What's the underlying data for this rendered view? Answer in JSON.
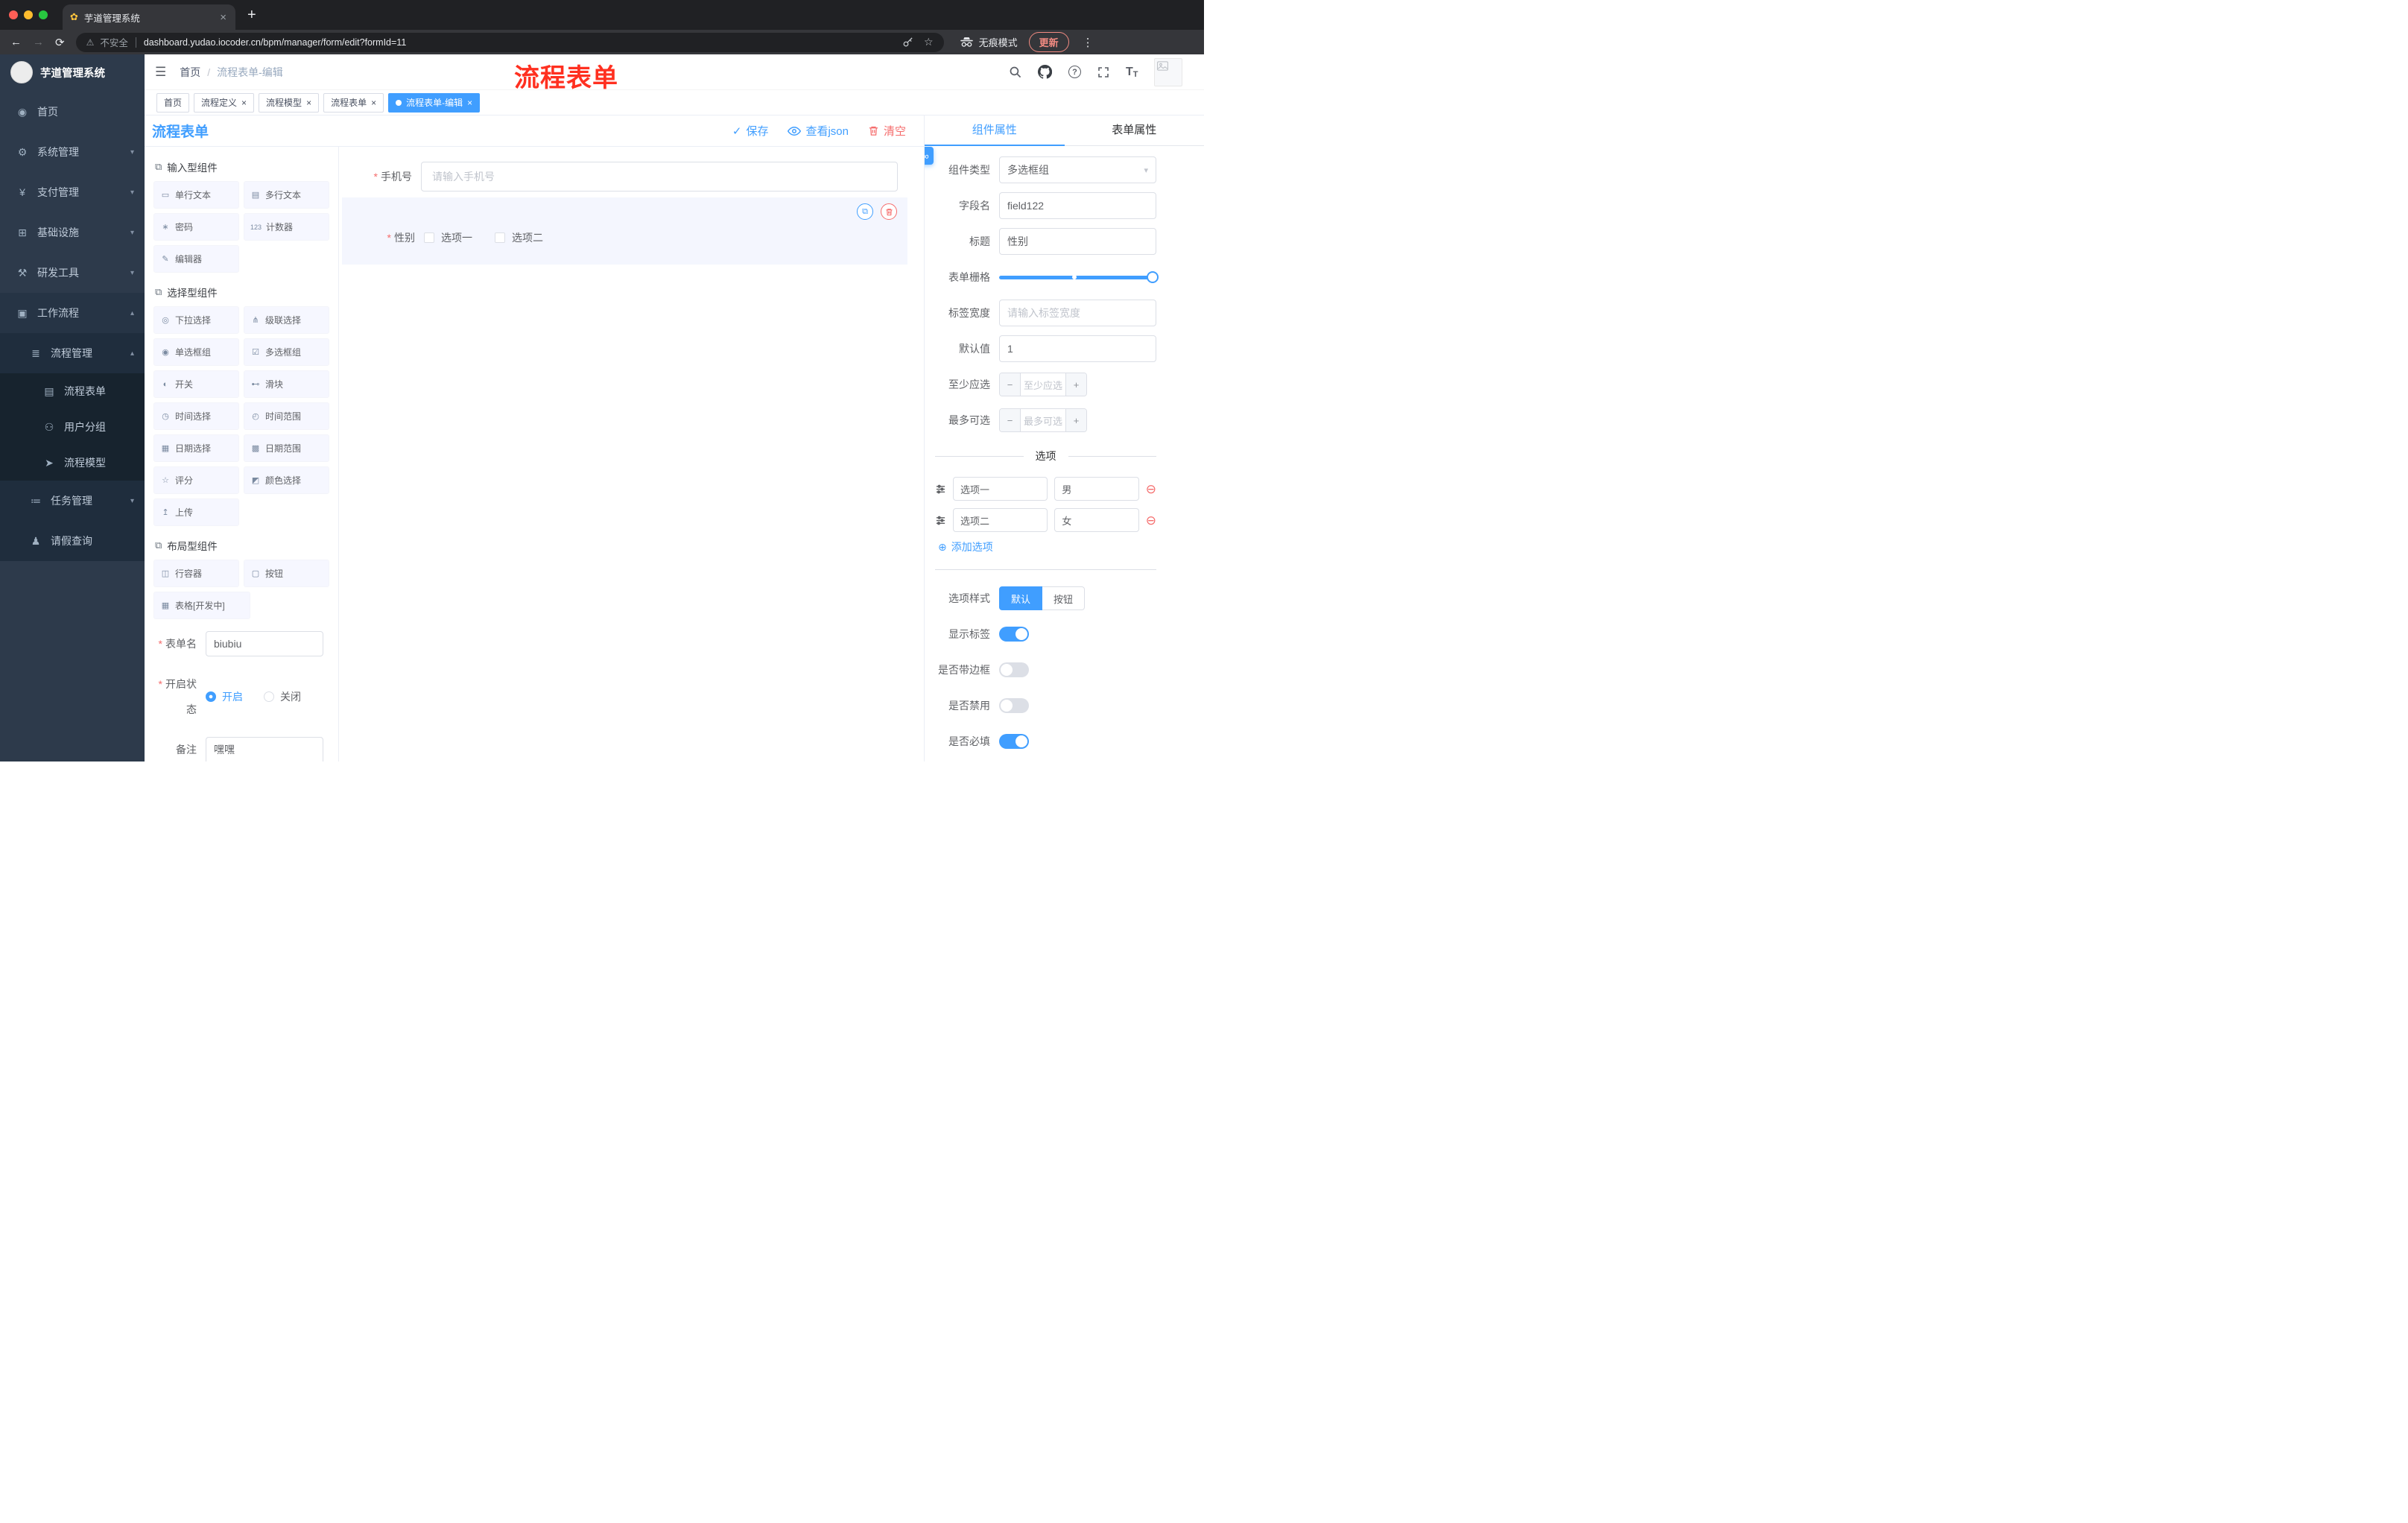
{
  "colors": {
    "accent": "#409eff",
    "danger": "#f56c6c",
    "annotation_red": "#ff3020",
    "sidebar_bg": "#2d3a4b",
    "tag_active": "#409eff"
  },
  "icons": {
    "favicon": "✿",
    "close": "×",
    "plus": "+",
    "minus": "−",
    "back": "←",
    "forward": "→",
    "reload": "⟳",
    "warning": "⚠",
    "star": "☆",
    "kebab": "⋮",
    "hamburger": "☰",
    "question": "?",
    "caret_down": "▾",
    "caret_up": "▴",
    "dropdown": "▾",
    "check": "✓",
    "copy": "⧉",
    "add": "⊕",
    "remove": "⊖",
    "link": "∞",
    "dot": "●",
    "group": "⧉",
    "slash": "/"
  },
  "browser": {
    "tab_title": "芋道管理系统",
    "security": "不安全",
    "url": "dashboard.yudao.iocoder.cn/bpm/manager/form/edit?formId=11",
    "incognito": "无痕模式",
    "update": "更新"
  },
  "sidebar": {
    "logo_title": "芋道管理系统",
    "items": [
      {
        "label": "首页",
        "icon": "◉"
      },
      {
        "label": "系统管理",
        "icon": "⚙"
      },
      {
        "label": "支付管理",
        "icon": "¥"
      },
      {
        "label": "基础设施",
        "icon": "⊞"
      },
      {
        "label": "研发工具",
        "icon": "⚒"
      },
      {
        "label": "工作流程",
        "icon": "▣"
      },
      {
        "label": "流程管理",
        "icon": "≣"
      },
      {
        "label": "流程表单",
        "icon": "▤"
      },
      {
        "label": "用户分组",
        "icon": "⚇"
      },
      {
        "label": "流程模型",
        "icon": "➤"
      },
      {
        "label": "任务管理",
        "icon": "≔"
      },
      {
        "label": "请假查询",
        "icon": "♟"
      }
    ]
  },
  "header": {
    "breadcrumb_home": "首页",
    "breadcrumb_current": "流程表单-编辑",
    "annotation": "流程表单",
    "font_icon": "T"
  },
  "tags": [
    {
      "label": "首页"
    },
    {
      "label": "流程定义"
    },
    {
      "label": "流程模型"
    },
    {
      "label": "流程表单"
    },
    {
      "label": "流程表单-编辑"
    }
  ],
  "designer": {
    "title": "流程表单",
    "save": "保存",
    "view_json": "查看json",
    "clear": "清空",
    "groups": [
      {
        "title": "输入型组件",
        "items": [
          {
            "label": "单行文本",
            "icon": "▭"
          },
          {
            "label": "多行文本",
            "icon": "▤"
          },
          {
            "label": "密码",
            "icon": "∗"
          },
          {
            "label": "计数器",
            "icon": "123"
          },
          {
            "label": "编辑器",
            "icon": "✎"
          }
        ]
      },
      {
        "title": "选择型组件",
        "items": [
          {
            "label": "下拉选择",
            "icon": "◎"
          },
          {
            "label": "级联选择",
            "icon": "⋔"
          },
          {
            "label": "单选框组",
            "icon": "◉"
          },
          {
            "label": "多选框组",
            "icon": "☑"
          },
          {
            "label": "开关",
            "icon": "◐"
          },
          {
            "label": "滑块",
            "icon": "⊷"
          },
          {
            "label": "时间选择",
            "icon": "◷"
          },
          {
            "label": "时间范围",
            "icon": "◴"
          },
          {
            "label": "日期选择",
            "icon": "▦"
          },
          {
            "label": "日期范围",
            "icon": "▩"
          },
          {
            "label": "评分",
            "icon": "☆"
          },
          {
            "label": "颜色选择",
            "icon": "◩"
          },
          {
            "label": "上传",
            "icon": "↥"
          }
        ]
      },
      {
        "title": "布局型组件",
        "items": [
          {
            "label": "行容器",
            "icon": "◫"
          },
          {
            "label": "按钮",
            "icon": "▢"
          },
          {
            "label": "表格[开发中]",
            "icon": "▦"
          }
        ]
      }
    ],
    "form_config": {
      "form_name": {
        "label": "表单名",
        "value": "biubiu"
      },
      "status": {
        "label": "开启状态",
        "on": "开启",
        "off": "关闭"
      },
      "remark": {
        "label": "备注",
        "value": "嘿嘿"
      }
    },
    "canvas": {
      "phone": {
        "label": "手机号",
        "placeholder": "请输入手机号"
      },
      "gender": {
        "label": "性别",
        "option1": "选项一",
        "option2": "选项二"
      }
    }
  },
  "properties": {
    "tab_component": "组件属性",
    "tab_form": "表单属性",
    "component_type": {
      "label": "组件类型",
      "value": "多选框组"
    },
    "field_name": {
      "label": "字段名",
      "value": "field122"
    },
    "title": {
      "label": "标题",
      "value": "性别"
    },
    "grid": {
      "label": "表单栅格"
    },
    "label_width": {
      "label": "标签宽度",
      "placeholder": "请输入标签宽度"
    },
    "default_value": {
      "label": "默认值",
      "value": "1"
    },
    "min_select": {
      "label": "至少应选",
      "placeholder": "至少应选"
    },
    "max_select": {
      "label": "最多可选",
      "placeholder": "最多可选"
    },
    "options_title": "选项",
    "options": [
      {
        "label": "选项一",
        "value": "男"
      },
      {
        "label": "选项二",
        "value": "女"
      }
    ],
    "add_option": "添加选项",
    "option_style": {
      "label": "选项样式",
      "default": "默认",
      "button": "按钮"
    },
    "show_label": {
      "label": "显示标签",
      "on": true
    },
    "border": {
      "label": "是否带边框",
      "on": false
    },
    "disabled": {
      "label": "是否禁用",
      "on": false
    },
    "required": {
      "label": "是否必填",
      "on": true
    }
  }
}
